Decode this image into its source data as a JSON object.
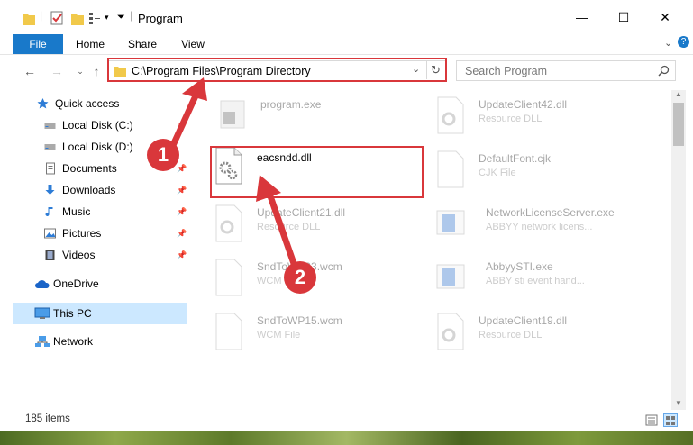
{
  "window": {
    "title": "Program",
    "controls": {
      "minimize": "—",
      "maximize": "☐",
      "close": "✕"
    }
  },
  "ribbon": {
    "tabs": [
      "File",
      "Home",
      "Share",
      "View"
    ]
  },
  "address": {
    "path": "C:\\Program Files\\Program Directory",
    "search_placeholder": "Search Program"
  },
  "nav": {
    "items": [
      {
        "label": "Quick access",
        "icon": "star-icon"
      },
      {
        "label": "Local Disk (C:)",
        "icon": "drive-icon"
      },
      {
        "label": "Local Disk (D:)",
        "icon": "drive-icon"
      },
      {
        "label": "Documents",
        "icon": "documents-icon"
      },
      {
        "label": "Downloads",
        "icon": "download-icon"
      },
      {
        "label": "Music",
        "icon": "music-icon"
      },
      {
        "label": "Pictures",
        "icon": "pictures-icon"
      },
      {
        "label": "Videos",
        "icon": "videos-icon"
      },
      {
        "label": "OneDrive",
        "icon": "cloud-icon"
      },
      {
        "label": "This PC",
        "icon": "computer-icon"
      },
      {
        "label": "Network",
        "icon": "network-icon"
      }
    ]
  },
  "files": {
    "col1": [
      {
        "name": "program.exe",
        "type": ""
      },
      {
        "name": "eacsndd.dll",
        "type": ""
      },
      {
        "name": "UpdateClient21.dll",
        "type": "Resource DLL"
      },
      {
        "name": "SndToWP93.wcm",
        "type": "WCM File"
      },
      {
        "name": "SndToWP15.wcm",
        "type": "WCM File"
      }
    ],
    "col2": [
      {
        "name": "UpdateClient42.dll",
        "type": "Resource DLL"
      },
      {
        "name": "DefaultFont.cjk",
        "type": "CJK File"
      },
      {
        "name": "NetworkLicenseServer.exe",
        "type": "ABBYY network licens..."
      },
      {
        "name": "AbbyySTI.exe",
        "type": "ABBY sti event hand..."
      },
      {
        "name": "UpdateClient19.dll",
        "type": "Resource DLL"
      }
    ]
  },
  "status": {
    "count": "185 items"
  },
  "annotations": {
    "step1": "1",
    "step2": "2"
  },
  "colors": {
    "accent": "#1979ca",
    "annotation": "#d9373b",
    "selected_nav": "#cce8ff"
  }
}
